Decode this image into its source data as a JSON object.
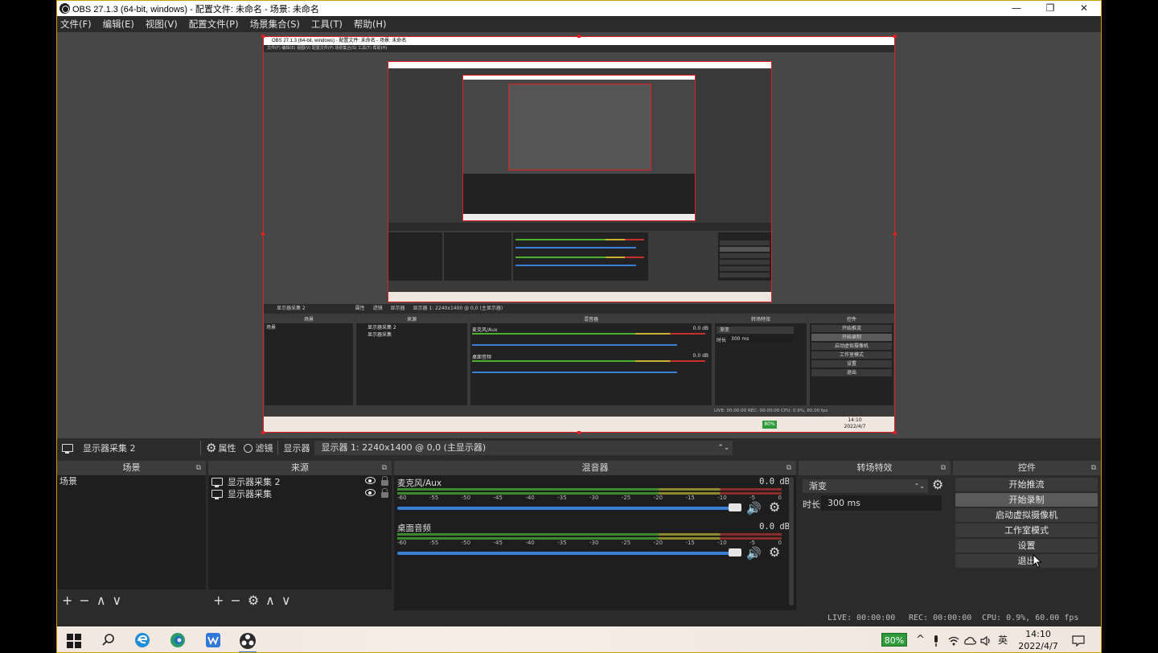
{
  "window": {
    "title": "OBS 27.1.3 (64-bit, windows) - 配置文件: 未命名 - 场景: 未命名",
    "min": "—",
    "max": "❐",
    "close": "✕"
  },
  "menu": [
    "文件(F)",
    "编辑(E)",
    "视图(V)",
    "配置文件(P)",
    "场景集合(S)",
    "工具(T)",
    "帮助(H)"
  ],
  "preview_nested": {
    "title": "OBS 27.1.3 (64-bit, windows) - 配置文件: 未命名 - 场景: 未命名",
    "menu": "文件(F)  编辑(E)  视图(V)  配置文件(P)  场景集合(S)  工具(T)  帮助(H)",
    "source_name": "显示器采集 2",
    "display_value": "显示器 1: 2240x1400 @ 0,0 (主显示器)",
    "props": "属性",
    "filters": "滤镜",
    "display_label": "显示器",
    "docks": [
      "场景",
      "来源",
      "混音器",
      "转场特效",
      "控件"
    ],
    "scene": "场景",
    "sources": [
      "显示器采集 2",
      "显示器采集"
    ],
    "mic": "麦克风/Aux",
    "desktop": "桌面音频",
    "db": "0.0 dB",
    "transition": "渐变",
    "duration_label": "时长",
    "duration": "300 ms",
    "controls": [
      "开始推流",
      "开始录制",
      "启动虚拟摄像机",
      "工作室模式",
      "设置",
      "退出"
    ],
    "status": "LIVE: 00:00:00   REC: 00:00:00   CPU: 0.9%, 60.00 fps",
    "battery": "80%",
    "time": "14:10",
    "date": "2022/4/7"
  },
  "source_toolbar": {
    "source_name": "显示器采集 2",
    "properties": "属性",
    "filters": "滤镜",
    "display_label": "显示器",
    "display_value": "显示器 1: 2240x1400 @ 0,0 (主显示器)"
  },
  "scenes": {
    "title": "场景",
    "items": [
      "场景"
    ]
  },
  "sources": {
    "title": "来源",
    "items": [
      "显示器采集 2",
      "显示器采集"
    ]
  },
  "mixer": {
    "title": "混音器",
    "channels": [
      {
        "name": "麦克风/Aux",
        "db": "0.0 dB"
      },
      {
        "name": "桌面音频",
        "db": "0.0 dB"
      }
    ],
    "ticks": [
      "-60",
      "-55",
      "-50",
      "-45",
      "-40",
      "-35",
      "-30",
      "-25",
      "-20",
      "-15",
      "-10",
      "-5",
      "0"
    ]
  },
  "transitions": {
    "title": "转场特效",
    "selected": "渐变",
    "duration_label": "时长",
    "duration_value": "300 ms"
  },
  "controls": {
    "title": "控件",
    "buttons": [
      "开始推流",
      "开始录制",
      "启动虚拟摄像机",
      "工作室模式",
      "设置",
      "退出"
    ]
  },
  "status": {
    "live": "LIVE: 00:00:00",
    "rec": "REC: 00:00:00",
    "cpu": "CPU: 0.9%, 60.00 fps"
  },
  "taskbar": {
    "battery": "80%",
    "ime": "英",
    "time": "14:10",
    "date": "2022/4/7"
  },
  "icons": {
    "gear": "⚙",
    "volume": "🔊",
    "plus": "+",
    "minus": "−",
    "up": "∧",
    "down": "∨",
    "popout": "⧉",
    "spin": "⌃⌄"
  },
  "colors": {
    "accent_red": "#e02020",
    "slider_blue": "#3b7fd9",
    "battery_green": "#2e9a3a"
  }
}
